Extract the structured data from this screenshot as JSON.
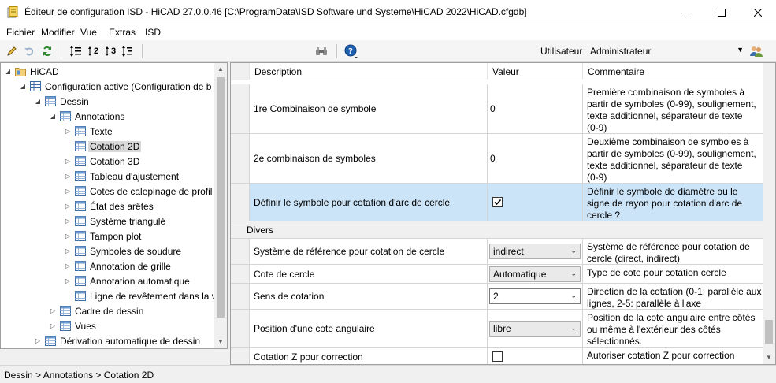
{
  "window": {
    "title": "Éditeur de configuration ISD - HiCAD 27.0.0.46 [C:\\ProgramData\\ISD Software und Systeme\\HiCAD 2022\\HiCAD.cfgdb]"
  },
  "menu": {
    "items": [
      "Fichier",
      "Modifier",
      "Vue",
      "Extras",
      "ISD"
    ]
  },
  "toolbar": {
    "user_label": "Utilisateur",
    "user_value": "Administrateur",
    "icons": [
      "pencil-icon",
      "undo-icon",
      "refresh-icon",
      "tree-level-all-icon",
      "tree-level-2-icon",
      "tree-level-3-icon",
      "tree-level-expand-icon",
      "binoculars-icon",
      "help-icon",
      "users-icon"
    ],
    "level_labels": [
      "2",
      "3"
    ]
  },
  "tree": {
    "items": [
      {
        "label": "HiCAD",
        "level": 0,
        "toggle": "expanded",
        "icon": "folder"
      },
      {
        "label": "Configuration active (Configuration de b",
        "level": 1,
        "toggle": "expanded",
        "icon": "grid"
      },
      {
        "label": "Dessin",
        "level": 2,
        "toggle": "expanded",
        "icon": "table"
      },
      {
        "label": "Annotations",
        "level": 3,
        "toggle": "expanded",
        "icon": "table"
      },
      {
        "label": "Texte",
        "level": 4,
        "toggle": "collapsed",
        "icon": "table"
      },
      {
        "label": "Cotation 2D",
        "level": 4,
        "toggle": "none",
        "icon": "table",
        "selected": true
      },
      {
        "label": "Cotation 3D",
        "level": 4,
        "toggle": "collapsed",
        "icon": "table"
      },
      {
        "label": "Tableau d'ajustement",
        "level": 4,
        "toggle": "collapsed",
        "icon": "table"
      },
      {
        "label": "Cotes de calepinage de profil",
        "level": 4,
        "toggle": "collapsed",
        "icon": "table"
      },
      {
        "label": "État des arêtes",
        "level": 4,
        "toggle": "collapsed",
        "icon": "table"
      },
      {
        "label": "Système triangulé",
        "level": 4,
        "toggle": "collapsed",
        "icon": "table"
      },
      {
        "label": "Tampon plot",
        "level": 4,
        "toggle": "collapsed",
        "icon": "table"
      },
      {
        "label": "Symboles de soudure",
        "level": 4,
        "toggle": "collapsed",
        "icon": "table"
      },
      {
        "label": "Annotation de grille",
        "level": 4,
        "toggle": "collapsed",
        "icon": "table"
      },
      {
        "label": "Annotation automatique",
        "level": 4,
        "toggle": "collapsed",
        "icon": "table"
      },
      {
        "label": "Ligne de revêtement dans la v",
        "level": 4,
        "toggle": "none",
        "icon": "table"
      },
      {
        "label": "Cadre de dessin",
        "level": 3,
        "toggle": "collapsed",
        "icon": "table"
      },
      {
        "label": "Vues",
        "level": 3,
        "toggle": "collapsed",
        "icon": "table"
      },
      {
        "label": "Dérivation automatique de dessin",
        "level": 2,
        "toggle": "collapsed",
        "icon": "table"
      }
    ]
  },
  "grid": {
    "headers": {
      "description": "Description",
      "value": "Valeur",
      "comment": "Commentaire"
    },
    "rows": [
      {
        "kind": "row",
        "description": "1re Combinaison de symbole",
        "value_type": "text",
        "value": "0",
        "comment": [
          "Première combinaison de symboles à",
          "partir de symboles (0-99), soulignement,",
          "texte additionnel, séparateur de texte",
          "(0-9)"
        ]
      },
      {
        "kind": "row",
        "description": "2e combinaison de symboles",
        "value_type": "text",
        "value": "0",
        "comment": [
          "Deuxième combinaison de symboles à",
          "partir de symboles (0-99), soulignement,",
          "texte additionnel, séparateur de texte",
          "(0-9)"
        ]
      },
      {
        "kind": "row",
        "description": "Définir le symbole pour cotation d'arc de cercle",
        "value_type": "checkbox",
        "checked": true,
        "selected": true,
        "comment": [
          "Définir le symbole de diamètre ou le",
          "signe de rayon pour cotation d'arc de",
          "cercle ?"
        ]
      },
      {
        "kind": "group",
        "label": "Divers"
      },
      {
        "kind": "row",
        "description": "Système de référence pour cotation de cercle",
        "value_type": "combo",
        "value": "indirect",
        "comment": [
          "Système de référence pour cotation de",
          "cercle (direct, indirect)"
        ]
      },
      {
        "kind": "row",
        "description": "Cote de cercle",
        "value_type": "combo",
        "value": "Automatique",
        "comment": [
          "Type de cote pour cotation cercle"
        ]
      },
      {
        "kind": "row",
        "description": "Sens de cotation",
        "value_type": "combo",
        "value": "2",
        "dark": true,
        "comment": [
          "Direction de la cotation (0-1: parallèle aux",
          "lignes, 2-5: parallèle à l'axe"
        ]
      },
      {
        "kind": "row",
        "description": "Position d'une cote angulaire",
        "value_type": "combo",
        "value": "libre",
        "comment": [
          "Position de la cote angulaire entre côtés",
          "ou même à l'extérieur des côtés",
          "sélectionnés."
        ]
      },
      {
        "kind": "row",
        "description": "Cotation Z pour correction",
        "value_type": "checkbox",
        "checked": false,
        "comment": [
          "Autoriser cotation Z pour correction"
        ]
      }
    ]
  },
  "status": {
    "breadcrumb": "Dessin > Annotations > Cotation 2D"
  },
  "colors": {
    "selection": "#cce4f7",
    "tree_selection": "#d9d9d9",
    "accent_blue": "#0078d7"
  }
}
